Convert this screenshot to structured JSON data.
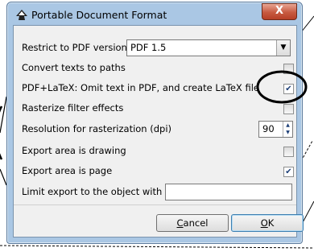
{
  "window": {
    "title": "Portable Document Format",
    "close_label": "X"
  },
  "options": {
    "restrict_label": "Restrict to PDF version",
    "restrict_value": "PDF 1.5",
    "convert_texts_label": "Convert texts to paths",
    "convert_texts_checked": false,
    "pdf_latex_label": "PDF+LaTeX: Omit text in PDF, and create LaTeX file",
    "pdf_latex_checked": true,
    "rasterize_label": "Rasterize filter effects",
    "rasterize_checked": false,
    "resolution_label": "Resolution for rasterization (dpi)",
    "resolution_value": "90",
    "export_drawing_label": "Export area is drawing",
    "export_drawing_checked": false,
    "export_page_label": "Export area is page",
    "export_page_checked": true,
    "limit_export_label": "Limit export to the object with ID",
    "limit_export_value": ""
  },
  "buttons": {
    "cancel_first": "C",
    "cancel_rest": "ancel",
    "ok_first": "O",
    "ok_rest": "K"
  },
  "check_glyph": "✔",
  "colors": {
    "titlebar": "#aac7e4",
    "close": "#c75a40",
    "annotation": "#000000"
  }
}
